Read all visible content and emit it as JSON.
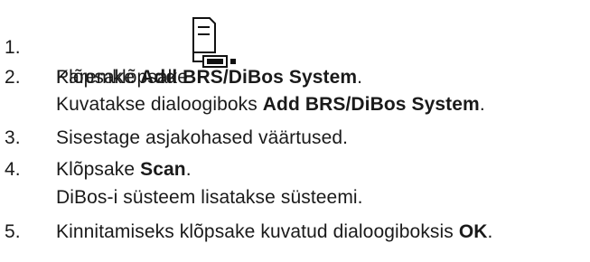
{
  "steps": [
    {
      "number": "1.",
      "text": "Paremklõpsake",
      "icon": "bvms-device-tree-icon",
      "after_icon": "."
    },
    {
      "number": "2.",
      "prefix": "Klõpsake ",
      "bold": "Add BRS/DiBos System",
      "suffix": ".",
      "sub_prefix": "Kuvatakse dialoogiboks ",
      "sub_bold": "Add BRS/DiBos System",
      "sub_suffix": "."
    },
    {
      "number": "3.",
      "text": "Sisestage asjakohased väärtused."
    },
    {
      "number": "4.",
      "prefix": "Klõpsake ",
      "bold": "Scan",
      "suffix": ".",
      "sub_text": "DiBos-i süsteem lisatakse süsteemi."
    },
    {
      "number": "5.",
      "prefix": "Kinnitamiseks klõpsake kuvatud dialoogiboksis ",
      "bold": "OK",
      "suffix": "."
    }
  ]
}
